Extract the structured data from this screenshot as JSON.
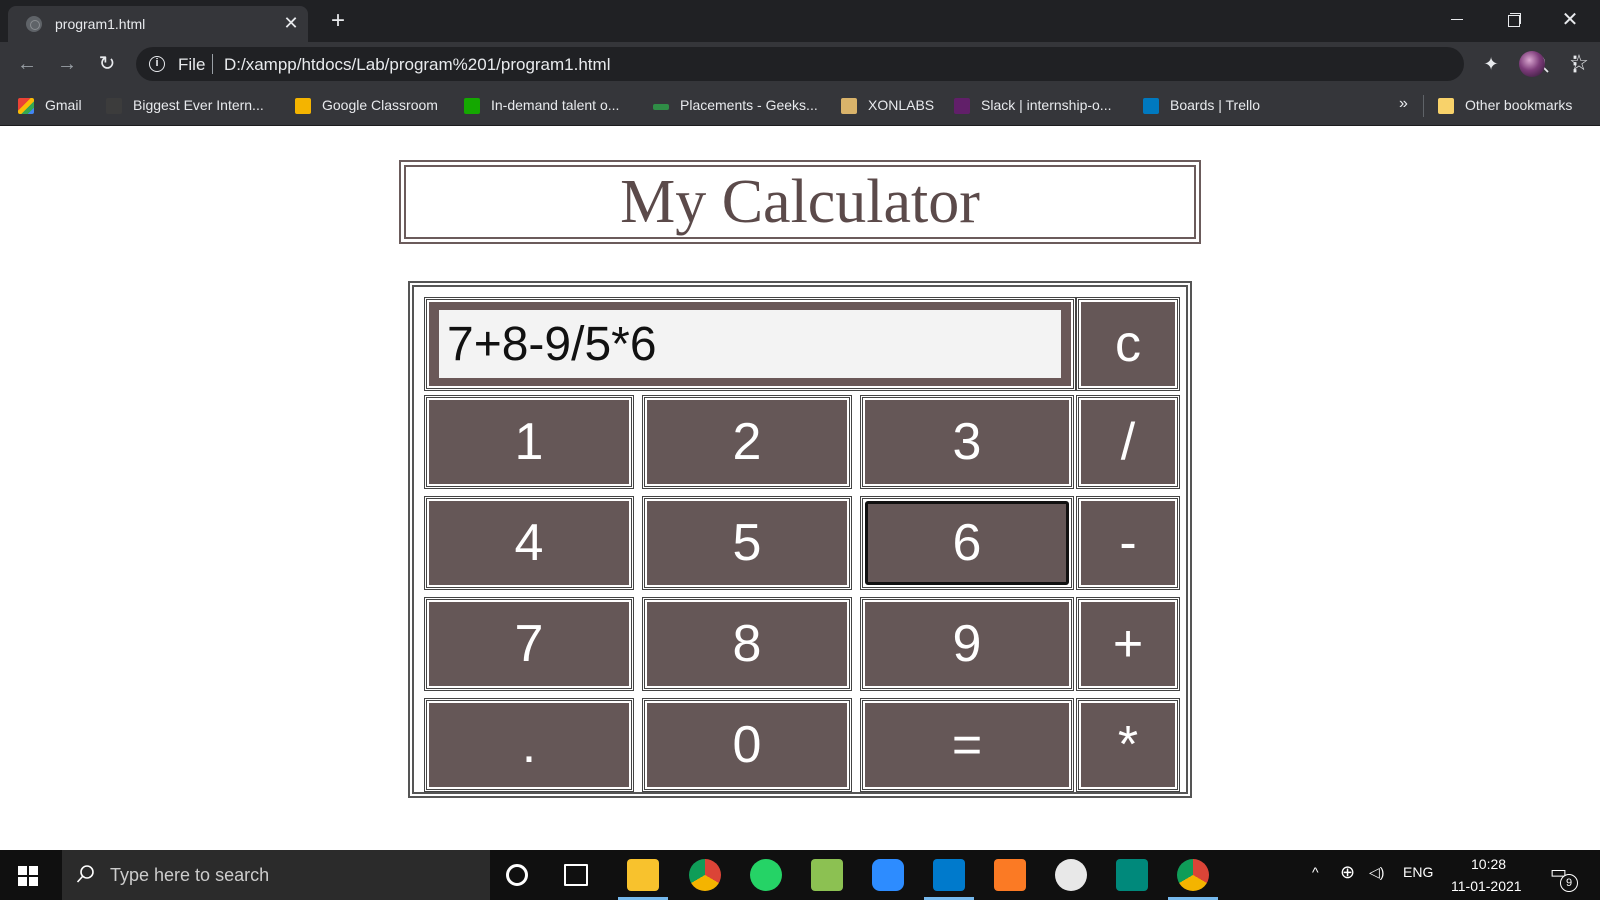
{
  "browser": {
    "tab_title": "program1.html",
    "close_glyph": "✕",
    "new_tab_glyph": "+",
    "win_close_glyph": "✕",
    "back_glyph": "←",
    "forward_glyph": "→",
    "reload_glyph": "↻",
    "info_glyph": "i",
    "address_scheme": "File",
    "address_url": "D:/xampp/htdocs/Lab/program%201/program1.html",
    "star_glyph": "☆",
    "ext_glyph": "✦",
    "menu_glyph": "⋮",
    "more_glyph": "»",
    "bookmarks": [
      {
        "label": "Gmail",
        "icon": "gmail-icon",
        "color": "#ea4335"
      },
      {
        "label": "Biggest Ever Intern...",
        "icon": "sb-icon",
        "color": "#3c3c3c"
      },
      {
        "label": "Google Classroom",
        "icon": "classroom-icon",
        "color": "#f4b400"
      },
      {
        "label": "In-demand talent o...",
        "icon": "upwork-icon",
        "color": "#14a800"
      },
      {
        "label": "Placements - Geeks...",
        "icon": "geeksforgeeks-icon",
        "color": "#2f8d46"
      },
      {
        "label": "XONLABS",
        "icon": "xonlabs-icon",
        "color": "#d9b36a"
      },
      {
        "label": "Slack | internship-o...",
        "icon": "slack-icon",
        "color": "#611f69"
      },
      {
        "label": "Boards | Trello",
        "icon": "trello-icon",
        "color": "#0079bf"
      }
    ],
    "other_bookmarks": "Other bookmarks"
  },
  "page": {
    "title": "My Calculator",
    "display_value": "7+8-9/5*6",
    "clear_label": "c",
    "keys": [
      [
        "1",
        "2",
        "3",
        "/"
      ],
      [
        "4",
        "5",
        "6",
        "-"
      ],
      [
        "7",
        "8",
        "9",
        "+"
      ],
      [
        ".",
        "0",
        "=",
        "*"
      ]
    ],
    "focused_key": "6"
  },
  "taskbar": {
    "search_placeholder": "Type here to search",
    "tray_language": "ENG",
    "tray_up_glyph": "^",
    "tray_network_glyph": "⊕",
    "tray_volume_glyph": "◁)",
    "notification_glyph": "▭",
    "time": "10:28",
    "date": "11-01-2021",
    "notification_count": "9",
    "apps": [
      {
        "name": "cortana-icon",
        "color": "#ffffff"
      },
      {
        "name": "task-view-icon",
        "color": "#ffffff"
      },
      {
        "name": "file-explorer-icon",
        "color": "#f8c22d"
      },
      {
        "name": "chrome-icon",
        "color": "#db4437"
      },
      {
        "name": "whatsapp-icon",
        "color": "#25d366"
      },
      {
        "name": "notepad-plus-icon",
        "color": "#8cc152"
      },
      {
        "name": "zoom-icon",
        "color": "#2d8cff"
      },
      {
        "name": "vscode-icon",
        "color": "#007acc"
      },
      {
        "name": "xampp-icon",
        "color": "#fb7a24"
      },
      {
        "name": "acrobat-icon",
        "color": "#e8e8e8"
      },
      {
        "name": "meet-icon",
        "color": "#00897b"
      },
      {
        "name": "chrome-profile-icon",
        "color": "#db4437"
      }
    ]
  }
}
